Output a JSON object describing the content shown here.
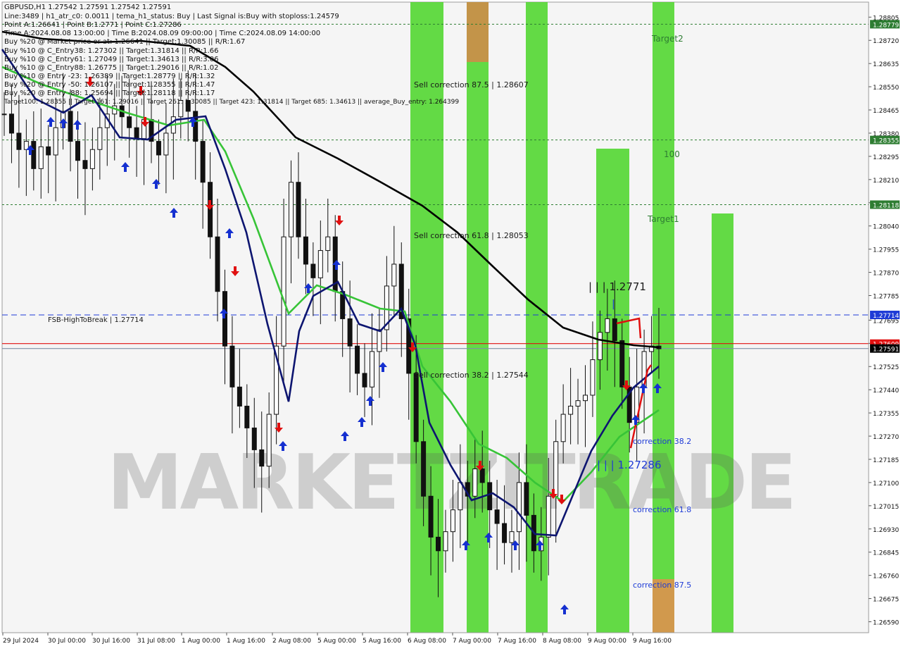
{
  "chart_data": {
    "type": "candlestick",
    "symbol": "GBPUSD",
    "timeframe": "H1",
    "header": {
      "title": "GBPUSD,H1  1.27542 1.27591 1.27542 1.27591",
      "lines": [
        "Line:3489 | h1_atr_c0: 0.0011 | tema_h1_status: Buy | Last Signal is:Buy with stoploss:1.24579",
        "Point A:1.26641 | Point B:1.2771 | Point C:1.27286",
        "Time A:2024.08.08 13:00:00 | Time B:2024.08.09 09:00:00 | Time C:2024.08.09 14:00:00",
        "Buy %20 @ Market price or at: 1.26641 || Target:1.30085 || R/R:1.67",
        "Buy %10 @ C_Entry38: 1.27302 || Target:1.31814 || R/R:1.66",
        "Buy %10 @ C_Entry61: 1.27049 || Target:1.34613 || R/R:3.06",
        "Buy %10 @ C_Entry88: 1.26775 || Target:1.29016 || R/R:1.02",
        "Buy %10 @ Entry -23: 1.26389 || Target:1.28779 || R/R:1.32",
        "Buy %20 @ Entry -50: 1.26107 || Target:1.28355 || R/R:1.47",
        "Buy %20 @ Entry -88: 1.25694 || Target:1.28118 || R/R:1.17",
        "Target100: 1.28355 || Target 161: 1.29016 || Target 261: 1.30085 || Target 423: 1.31814 || Target 685: 1.34613 || average_Buy_entry: 1.264399"
      ]
    },
    "y_axis": {
      "ticks": [
        "1.28805",
        "1.28720",
        "1.28635",
        "1.28550",
        "1.28465",
        "1.28380",
        "1.28295",
        "1.28210",
        "1.28125",
        "1.28040",
        "1.27955",
        "1.27870",
        "1.27785",
        "1.27695",
        "1.27610",
        "1.27525",
        "1.27440",
        "1.27355",
        "1.27270",
        "1.27185",
        "1.27100",
        "1.27015",
        "1.26930",
        "1.26845",
        "1.26760",
        "1.26675",
        "1.26590"
      ],
      "range": [
        1.2655,
        1.2886
      ],
      "badges": [
        {
          "label": "1.28779",
          "color": "#2e7d32"
        },
        {
          "label": "1.28355",
          "color": "#2e7d32"
        },
        {
          "label": "1.28118",
          "color": "#2e7d32"
        },
        {
          "label": "1.27714",
          "color": "#1e3bd6"
        },
        {
          "label": "1.27609",
          "color": "#e01010"
        },
        {
          "label": "1.27591",
          "color": "#000000"
        }
      ]
    },
    "x_axis": {
      "ticks": [
        "29 Jul 2024",
        "30 Jul 00:00",
        "30 Jul 16:00",
        "31 Jul 08:00",
        "1 Aug 00:00",
        "1 Aug 16:00",
        "2 Aug 08:00",
        "5 Aug 00:00",
        "5 Aug 16:00",
        "6 Aug 08:00",
        "7 Aug 00:00",
        "7 Aug 16:00",
        "8 Aug 08:00",
        "9 Aug 00:00",
        "9 Aug 16:00"
      ]
    },
    "levels": [
      {
        "name": "Target2",
        "value": 1.28779,
        "style": "dashed",
        "color": "#2e7d32"
      },
      {
        "name": "100",
        "value": 1.28355,
        "style": "dashed",
        "color": "#2e7d32"
      },
      {
        "name": "Target1",
        "value": 1.28118,
        "style": "dashed",
        "color": "#2e7d32"
      },
      {
        "name": "FSB-HighToBreak",
        "label": "FSB-HighToBreak | 1.27714",
        "value": 1.27714,
        "style": "dashed",
        "color": "#1e3bd6"
      },
      {
        "name": "current",
        "value": 1.27609,
        "style": "solid",
        "color": "#e01010"
      },
      {
        "name": "bid",
        "value": 1.27591,
        "style": "solid",
        "color": "#7f8fa6"
      }
    ],
    "annotations": [
      {
        "text": "Sell correction 87.5 | 1.28607"
      },
      {
        "text": "Sell correction 61.8 | 1.28053"
      },
      {
        "text": "Sell correction 38.2 | 1.27544"
      },
      {
        "text": "| | | 1.2771"
      },
      {
        "text": "| | | 1.27286"
      },
      {
        "text": "correction 38.2"
      },
      {
        "text": "correction 61.8"
      },
      {
        "text": "correction 87.5"
      },
      {
        "text": "Target2"
      },
      {
        "text": "100"
      },
      {
        "text": "Target1"
      }
    ],
    "watermark": "MARKETZITRADE",
    "candles_approx": [
      1.2845,
      1.2838,
      1.2832,
      1.2835,
      1.2825,
      1.2833,
      1.283,
      1.284,
      1.2846,
      1.2835,
      1.2828,
      1.2825,
      1.2832,
      1.284,
      1.2845,
      1.2848,
      1.2844,
      1.284,
      1.2836,
      1.2843,
      1.2835,
      1.283,
      1.2838,
      1.2844,
      1.285,
      1.2846,
      1.2835,
      1.282,
      1.28,
      1.278,
      1.276,
      1.2745,
      1.2738,
      1.273,
      1.2722,
      1.2716,
      1.2735,
      1.276,
      1.28,
      1.282,
      1.28,
      1.279,
      1.2785,
      1.2795,
      1.28,
      1.278,
      1.277,
      1.276,
      1.275,
      1.2745,
      1.2758,
      1.2766,
      1.2782,
      1.279,
      1.277,
      1.275,
      1.2725,
      1.2705,
      1.269,
      1.2685,
      1.2692,
      1.27,
      1.271,
      1.2705,
      1.2715,
      1.271,
      1.27,
      1.2695,
      1.2688,
      1.2692,
      1.271,
      1.2698,
      1.2685,
      1.269,
      1.2705,
      1.2725,
      1.2735,
      1.2738,
      1.274,
      1.2742,
      1.2755,
      1.2765,
      1.277,
      1.2762,
      1.2745,
      1.2732,
      1.2745,
      1.2758,
      1.276,
      1.2759
    ]
  }
}
